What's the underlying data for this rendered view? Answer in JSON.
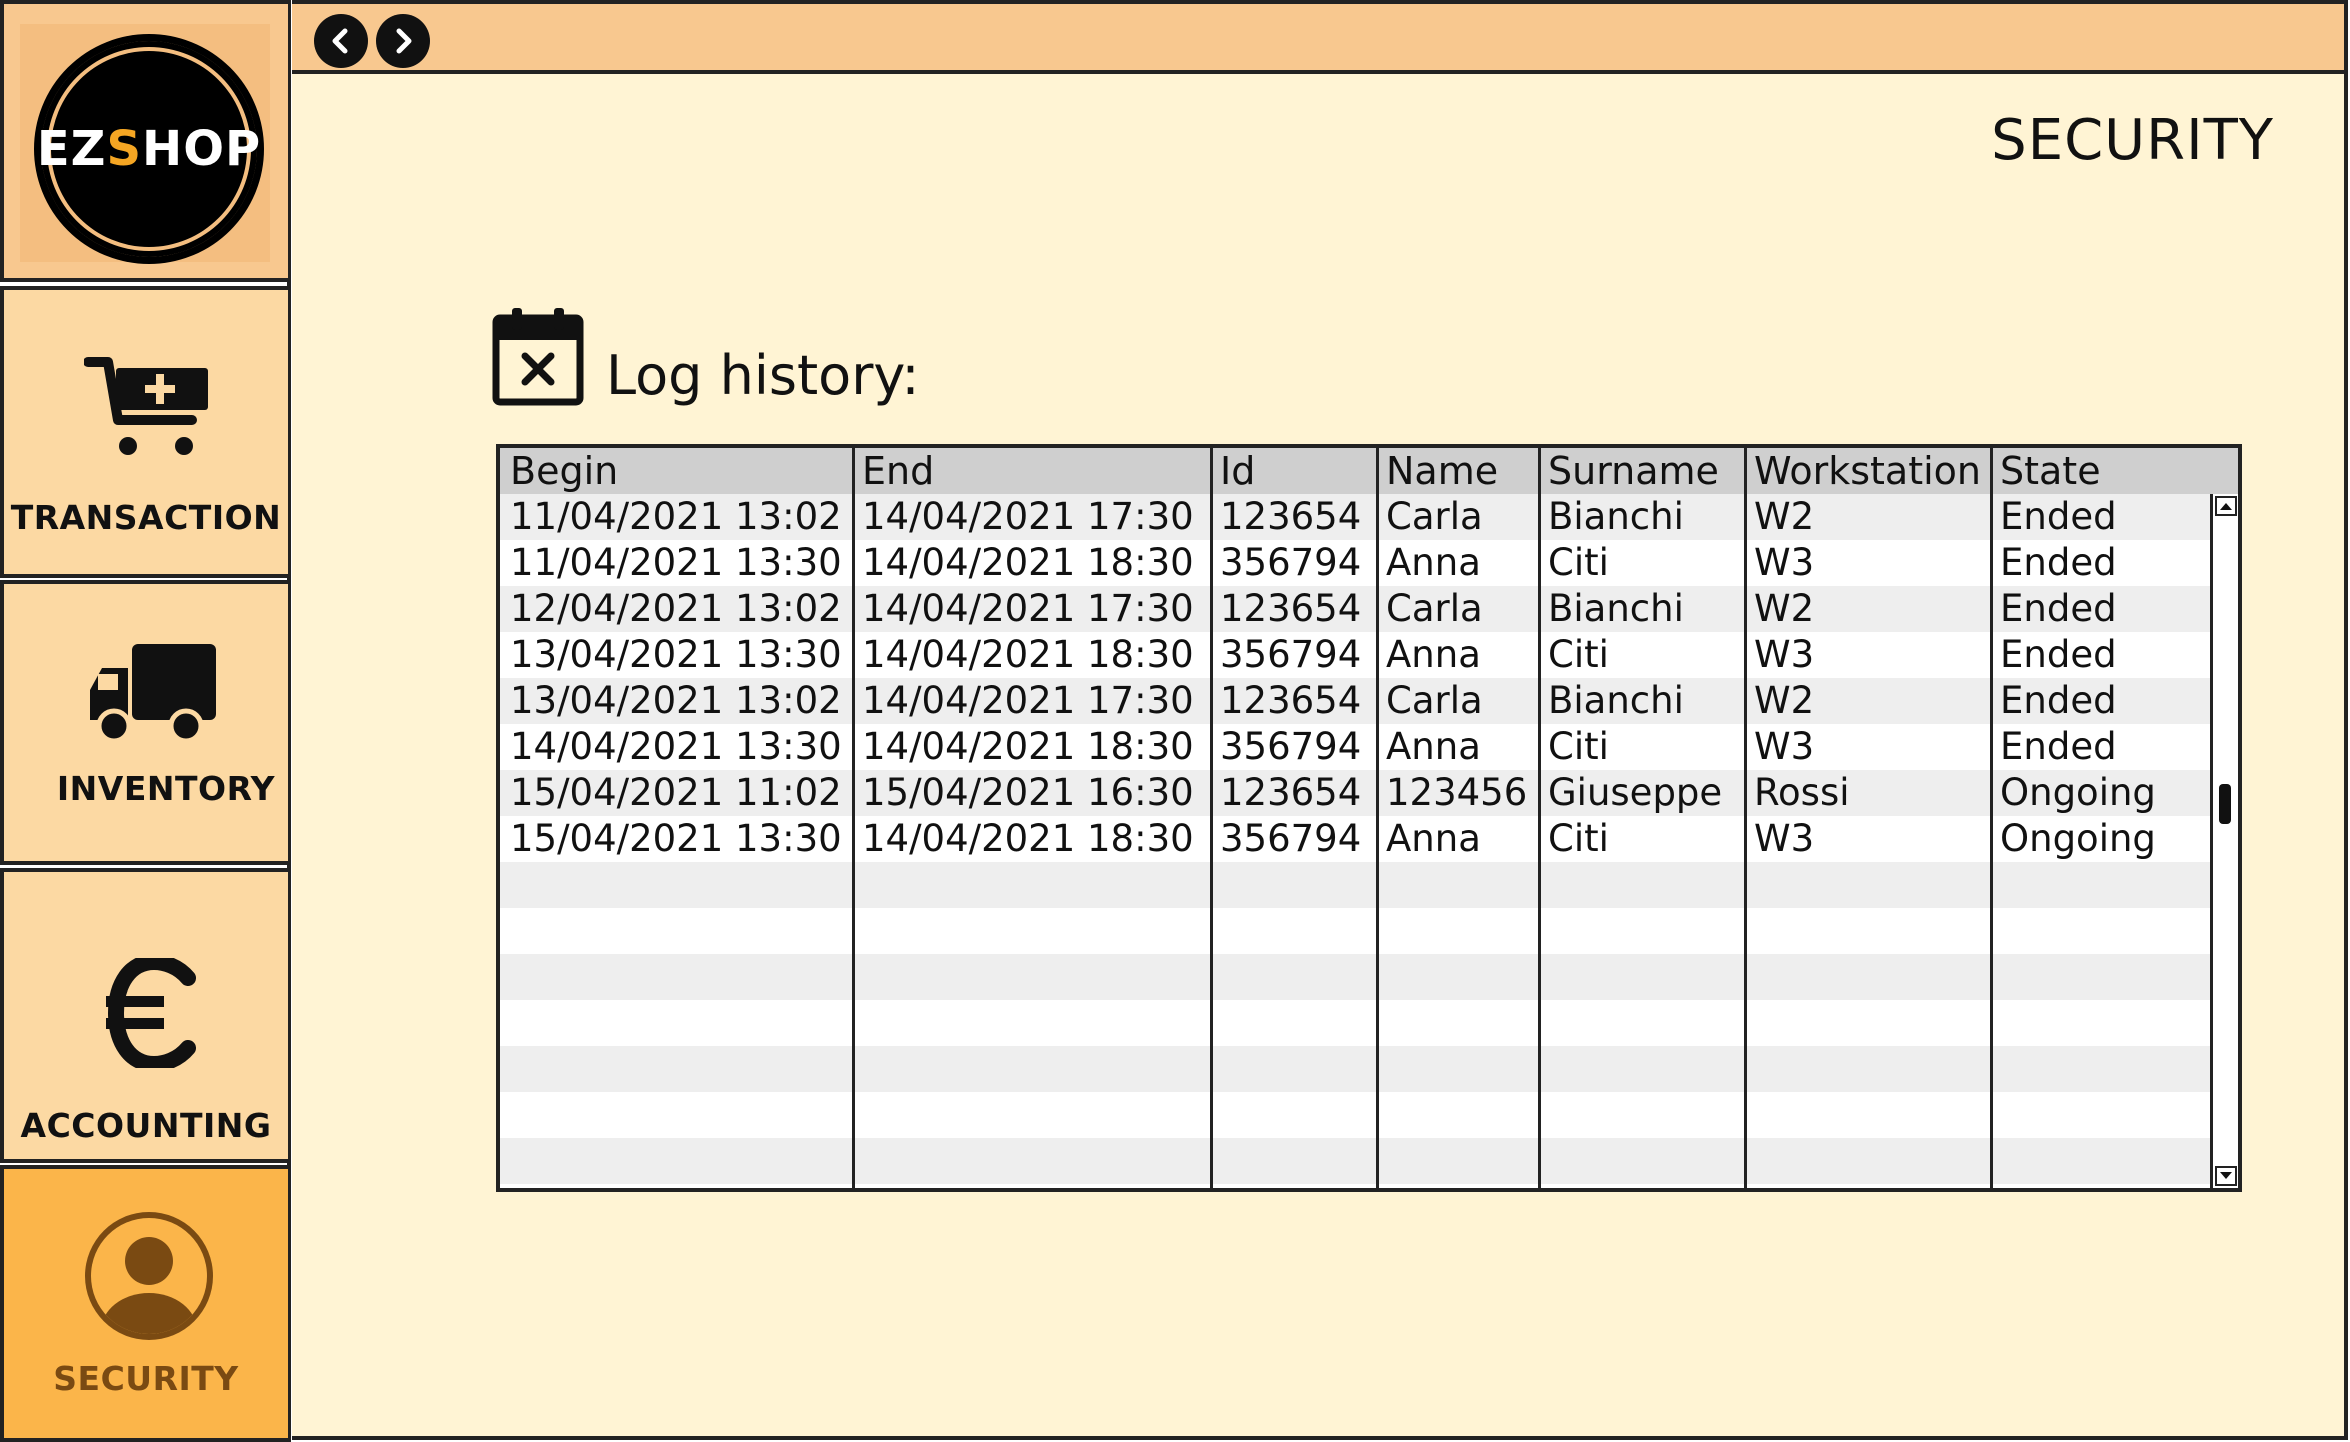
{
  "sidebar": {
    "logo": {
      "text_prefix": "EZ",
      "text_accent": "S",
      "text_suffix": "HOP",
      "icon": "ezshop-logo"
    },
    "items": [
      {
        "label": "TRANSACTION",
        "icon": "cart-plus-icon"
      },
      {
        "label": "INVENTORY",
        "icon": "truck-icon"
      },
      {
        "label": "ACCOUNTING",
        "icon": "euro-icon"
      },
      {
        "label": "SECURITY",
        "icon": "user-icon",
        "active": true
      }
    ]
  },
  "topbar": {
    "back_icon": "chevron-left-icon",
    "forward_icon": "chevron-right-icon"
  },
  "main": {
    "page_title": "SECURITY",
    "section_title": "Log history:",
    "section_icon": "calendar-x-icon"
  },
  "table": {
    "columns": [
      "Begin",
      "End",
      "Id",
      "Name",
      "Surname",
      "Workstation",
      "State"
    ],
    "rows": [
      [
        "11/04/2021 13:02",
        "14/04/2021 17:30",
        "123654",
        "Carla",
        "Bianchi",
        "W2",
        "Ended"
      ],
      [
        "11/04/2021 13:30",
        "14/04/2021 18:30",
        "356794",
        "Anna",
        "Citi",
        "W3",
        "Ended"
      ],
      [
        "12/04/2021 13:02",
        "14/04/2021 17:30",
        "123654",
        "Carla",
        "Bianchi",
        "W2",
        "Ended"
      ],
      [
        "13/04/2021 13:30",
        "14/04/2021 18:30",
        "356794",
        "Anna",
        "Citi",
        "W3",
        "Ended"
      ],
      [
        "13/04/2021 13:02",
        "14/04/2021 17:30",
        "123654",
        "Carla",
        "Bianchi",
        "W2",
        "Ended"
      ],
      [
        "14/04/2021 13:30",
        "14/04/2021 18:30",
        "356794",
        "Anna",
        "Citi",
        "W3",
        "Ended"
      ],
      [
        "15/04/2021 11:02",
        "15/04/2021 16:30",
        "123654",
        "123456",
        "Giuseppe",
        "Rossi",
        "Ongoing"
      ],
      [
        "15/04/2021 13:30",
        "14/04/2021 18:30",
        "356794",
        "Anna",
        "Citi",
        "W3",
        "Ongoing"
      ]
    ],
    "empty_rows": 8
  },
  "colors": {
    "sidebar_tile": "#fcd9a3",
    "sidebar_active": "#fbb54a",
    "topbar": "#f8c88f",
    "main_bg": "#fff4d4",
    "table_header": "#cfcfcf",
    "row_alt": "#eeeeee"
  }
}
